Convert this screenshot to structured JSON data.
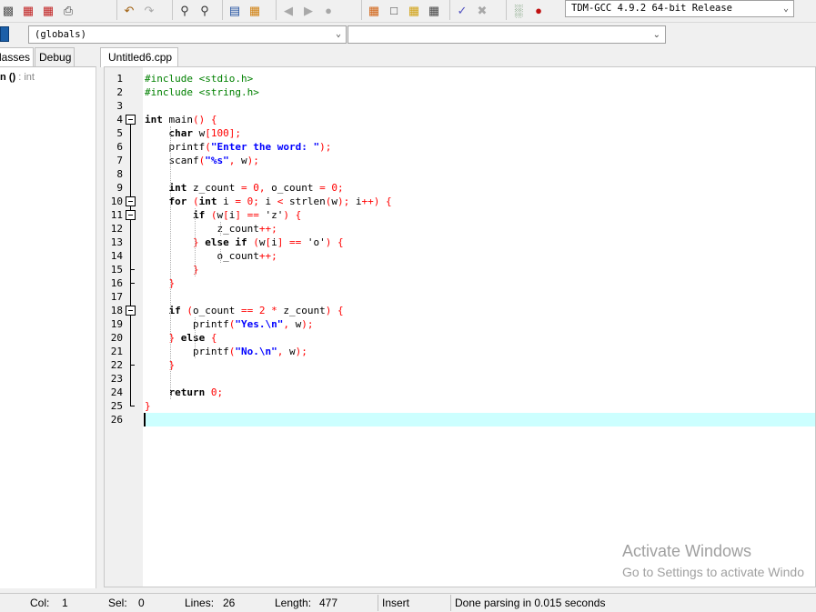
{
  "toolbar": {
    "compiler": "TDM-GCC 4.9.2 64-bit Release"
  },
  "toolbar2": {
    "scope_select": "(globals)",
    "members_select": ""
  },
  "left_panel": {
    "tabs": [
      "lasses",
      "Debug"
    ],
    "tree_item_name": "in",
    "tree_item_parens": " ()",
    "tree_item_type": " : int"
  },
  "editor": {
    "file_tab": "Untitled6.cpp",
    "line_numbers": [
      "1",
      "2",
      "3",
      "4",
      "5",
      "6",
      "7",
      "8",
      "9",
      "10",
      "11",
      "12",
      "13",
      "14",
      "15",
      "16",
      "17",
      "18",
      "19",
      "20",
      "21",
      "22",
      "23",
      "24",
      "25",
      "26"
    ],
    "active_line": 26
  },
  "code": [
    [
      [
        "pp",
        "#include <stdio.h>"
      ]
    ],
    [
      [
        "pp",
        "#include <string.h>"
      ]
    ],
    [],
    [
      [
        "kw",
        "int"
      ],
      [
        "pl",
        " main"
      ],
      [
        "sy",
        "() {"
      ]
    ],
    [
      [
        "pl",
        "    "
      ],
      [
        "kw",
        "char"
      ],
      [
        "pl",
        " w"
      ],
      [
        "sy",
        "["
      ],
      [
        "nu",
        "100"
      ],
      [
        "sy",
        "];"
      ]
    ],
    [
      [
        "pl",
        "    printf"
      ],
      [
        "sy",
        "("
      ],
      [
        "st",
        "\"Enter the word: \""
      ],
      [
        "sy",
        ");"
      ]
    ],
    [
      [
        "pl",
        "    scanf"
      ],
      [
        "sy",
        "("
      ],
      [
        "st",
        "\"%s\""
      ],
      [
        "sy",
        ","
      ],
      [
        "pl",
        " w"
      ],
      [
        "sy",
        ");"
      ]
    ],
    [],
    [
      [
        "pl",
        "    "
      ],
      [
        "kw",
        "int"
      ],
      [
        "pl",
        " z_count "
      ],
      [
        "sy",
        "="
      ],
      [
        "pl",
        " "
      ],
      [
        "nu",
        "0"
      ],
      [
        "sy",
        ","
      ],
      [
        "pl",
        " o_count "
      ],
      [
        "sy",
        "="
      ],
      [
        "pl",
        " "
      ],
      [
        "nu",
        "0"
      ],
      [
        "sy",
        ";"
      ]
    ],
    [
      [
        "pl",
        "    "
      ],
      [
        "kw",
        "for"
      ],
      [
        "pl",
        " "
      ],
      [
        "sy",
        "("
      ],
      [
        "kw",
        "int"
      ],
      [
        "pl",
        " i "
      ],
      [
        "sy",
        "="
      ],
      [
        "pl",
        " "
      ],
      [
        "nu",
        "0"
      ],
      [
        "sy",
        ";"
      ],
      [
        "pl",
        " i "
      ],
      [
        "sy",
        "<"
      ],
      [
        "pl",
        " strlen"
      ],
      [
        "sy",
        "("
      ],
      [
        "pl",
        "w"
      ],
      [
        "sy",
        ");"
      ],
      [
        "pl",
        " i"
      ],
      [
        "sy",
        "++)"
      ],
      [
        "pl",
        " "
      ],
      [
        "sy",
        "{"
      ]
    ],
    [
      [
        "pl",
        "        "
      ],
      [
        "kw",
        "if"
      ],
      [
        "pl",
        " "
      ],
      [
        "sy",
        "("
      ],
      [
        "pl",
        "w"
      ],
      [
        "sy",
        "["
      ],
      [
        "pl",
        "i"
      ],
      [
        "sy",
        "]"
      ],
      [
        "pl",
        " "
      ],
      [
        "sy",
        "=="
      ],
      [
        "pl",
        " 'z'"
      ],
      [
        "sy",
        ")"
      ],
      [
        "pl",
        " "
      ],
      [
        "sy",
        "{"
      ]
    ],
    [
      [
        "pl",
        "            z_count"
      ],
      [
        "sy",
        "++;"
      ]
    ],
    [
      [
        "pl",
        "        "
      ],
      [
        "sy",
        "}"
      ],
      [
        "pl",
        " "
      ],
      [
        "kw",
        "else if"
      ],
      [
        "pl",
        " "
      ],
      [
        "sy",
        "("
      ],
      [
        "pl",
        "w"
      ],
      [
        "sy",
        "["
      ],
      [
        "pl",
        "i"
      ],
      [
        "sy",
        "]"
      ],
      [
        "pl",
        " "
      ],
      [
        "sy",
        "=="
      ],
      [
        "pl",
        " 'o'"
      ],
      [
        "sy",
        ")"
      ],
      [
        "pl",
        " "
      ],
      [
        "sy",
        "{"
      ]
    ],
    [
      [
        "pl",
        "            o_count"
      ],
      [
        "sy",
        "++;"
      ]
    ],
    [
      [
        "pl",
        "        "
      ],
      [
        "sy",
        "}"
      ]
    ],
    [
      [
        "pl",
        "    "
      ],
      [
        "sy",
        "}"
      ]
    ],
    [],
    [
      [
        "pl",
        "    "
      ],
      [
        "kw",
        "if"
      ],
      [
        "pl",
        " "
      ],
      [
        "sy",
        "("
      ],
      [
        "pl",
        "o_count "
      ],
      [
        "sy",
        "=="
      ],
      [
        "pl",
        " "
      ],
      [
        "nu",
        "2"
      ],
      [
        "pl",
        " "
      ],
      [
        "sy",
        "*"
      ],
      [
        "pl",
        " z_count"
      ],
      [
        "sy",
        ")"
      ],
      [
        "pl",
        " "
      ],
      [
        "sy",
        "{"
      ]
    ],
    [
      [
        "pl",
        "        printf"
      ],
      [
        "sy",
        "("
      ],
      [
        "st",
        "\"Yes.\\n\""
      ],
      [
        "sy",
        ","
      ],
      [
        "pl",
        " w"
      ],
      [
        "sy",
        ");"
      ]
    ],
    [
      [
        "pl",
        "    "
      ],
      [
        "sy",
        "}"
      ],
      [
        "pl",
        " "
      ],
      [
        "kw",
        "else"
      ],
      [
        "pl",
        " "
      ],
      [
        "sy",
        "{"
      ]
    ],
    [
      [
        "pl",
        "        printf"
      ],
      [
        "sy",
        "("
      ],
      [
        "st",
        "\"No.\\n\""
      ],
      [
        "sy",
        ","
      ],
      [
        "pl",
        " w"
      ],
      [
        "sy",
        ");"
      ]
    ],
    [
      [
        "pl",
        "    "
      ],
      [
        "sy",
        "}"
      ]
    ],
    [],
    [
      [
        "pl",
        "    "
      ],
      [
        "kw",
        "return"
      ],
      [
        "pl",
        " "
      ],
      [
        "nu",
        "0"
      ],
      [
        "sy",
        ";"
      ]
    ],
    [
      [
        "sy",
        "}"
      ]
    ],
    []
  ],
  "watermark": {
    "title": "Activate Windows",
    "subtitle": "Go to Settings to activate Windo"
  },
  "statusbar": {
    "col_label": "Col:",
    "col_value": "1",
    "sel_label": "Sel:",
    "sel_value": "0",
    "lines_label": "Lines:",
    "lines_value": "26",
    "length_label": "Length:",
    "length_value": "477",
    "mode": "Insert",
    "message": "Done parsing in 0.015 seconds"
  }
}
